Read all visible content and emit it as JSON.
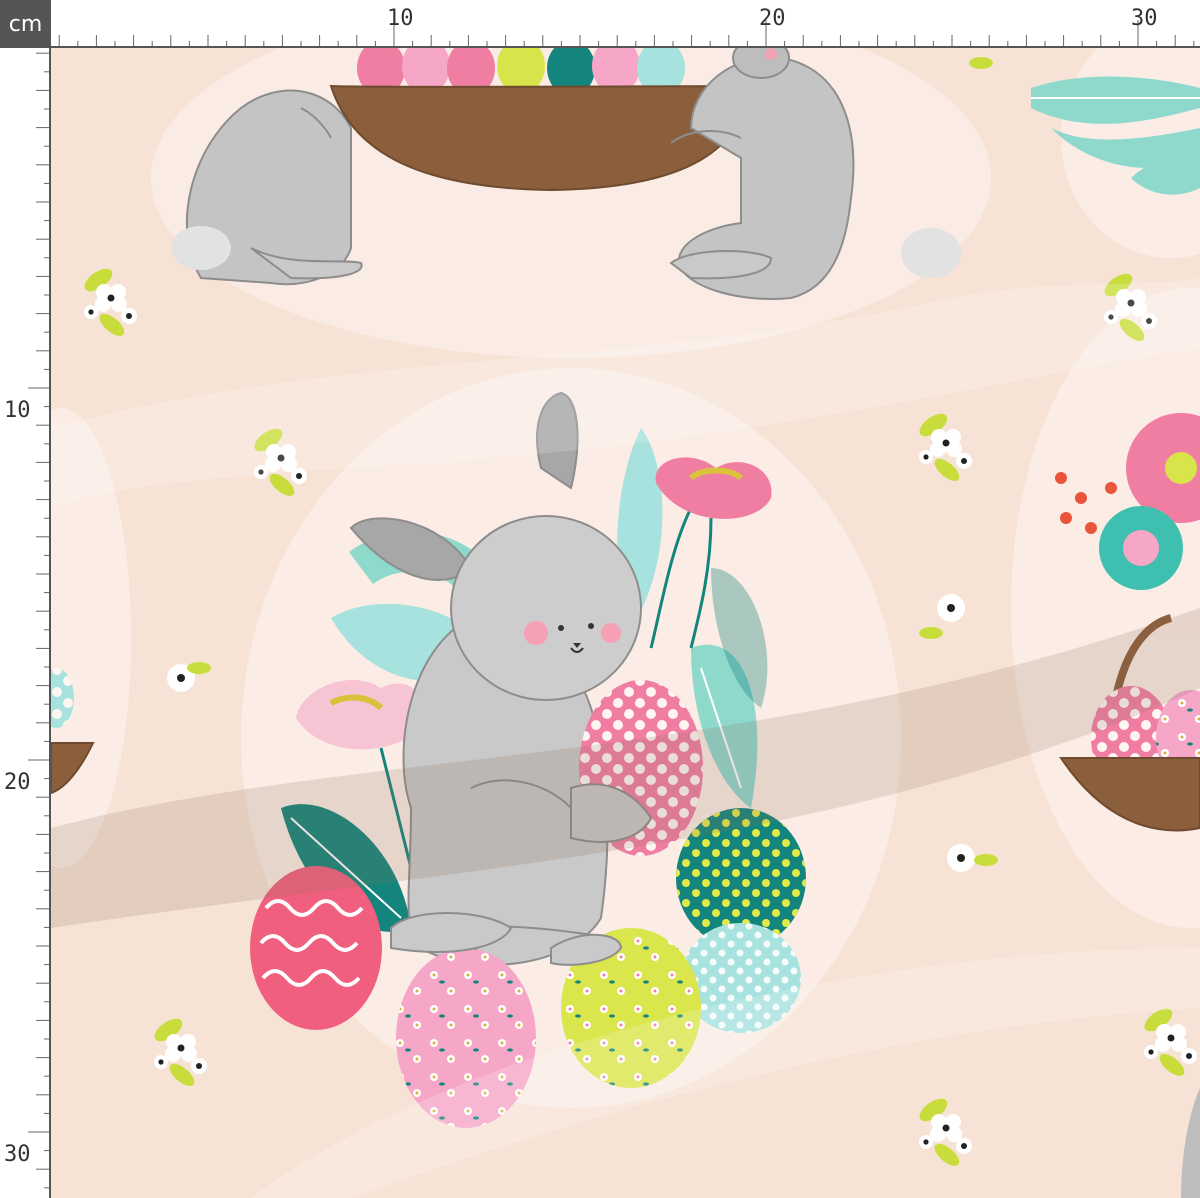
{
  "ruler": {
    "unit": "cm",
    "top_labels": [
      "10",
      "20",
      "30"
    ],
    "left_labels": [
      "10",
      "20",
      "30"
    ]
  },
  "fabric": {
    "background_color": "#f7e3d6",
    "medallion_color": "#fbefe8",
    "motifs": [
      "bunny",
      "easter-egg",
      "flower",
      "basket",
      "leaf"
    ],
    "palette": {
      "bunny_grey": "#bdbdbd",
      "egg_pink": "#f07ea3",
      "egg_yellow": "#d8e54a",
      "egg_teal": "#14857c",
      "egg_aqua": "#a8e2de",
      "basket_brown": "#8b5e3c",
      "leaf_mint": "#8fd8cc",
      "leaf_lime": "#c8dd3c"
    }
  }
}
